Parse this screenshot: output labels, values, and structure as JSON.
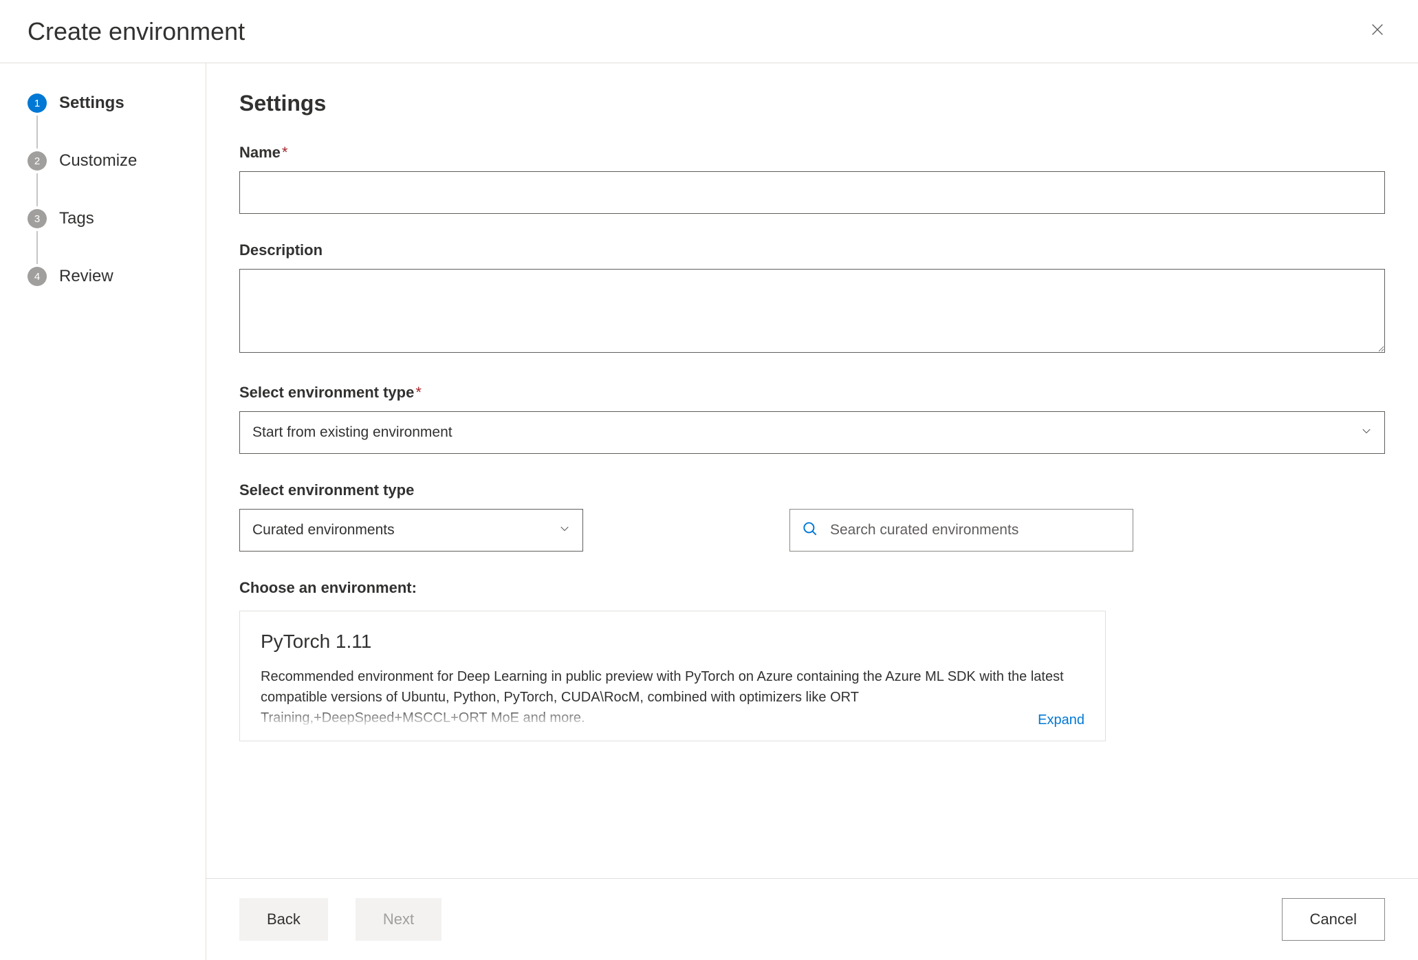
{
  "header": {
    "title": "Create environment"
  },
  "stepper": {
    "steps": [
      {
        "num": "1",
        "label": "Settings",
        "active": true
      },
      {
        "num": "2",
        "label": "Customize",
        "active": false
      },
      {
        "num": "3",
        "label": "Tags",
        "active": false
      },
      {
        "num": "4",
        "label": "Review",
        "active": false
      }
    ]
  },
  "page": {
    "heading": "Settings",
    "name_label": "Name",
    "name_value": "",
    "description_label": "Description",
    "description_value": "",
    "env_type_label": "Select environment type",
    "env_type_value": "Start from existing environment",
    "env_filter_label": "Select environment type",
    "env_filter_value": "Curated environments",
    "search_placeholder": "Search curated environments",
    "choose_label": "Choose an environment:",
    "env_card": {
      "title": "PyTorch 1.11",
      "description": "Recommended environment for Deep Learning in public preview with PyTorch on Azure containing the Azure ML SDK with the latest compatible versions of Ubuntu, Python, PyTorch, CUDA\\RocM, combined with optimizers like ORT Training,+DeepSpeed+MSCCL+ORT MoE and more.",
      "expand_label": "Expand"
    }
  },
  "footer": {
    "back_label": "Back",
    "next_label": "Next",
    "cancel_label": "Cancel"
  }
}
